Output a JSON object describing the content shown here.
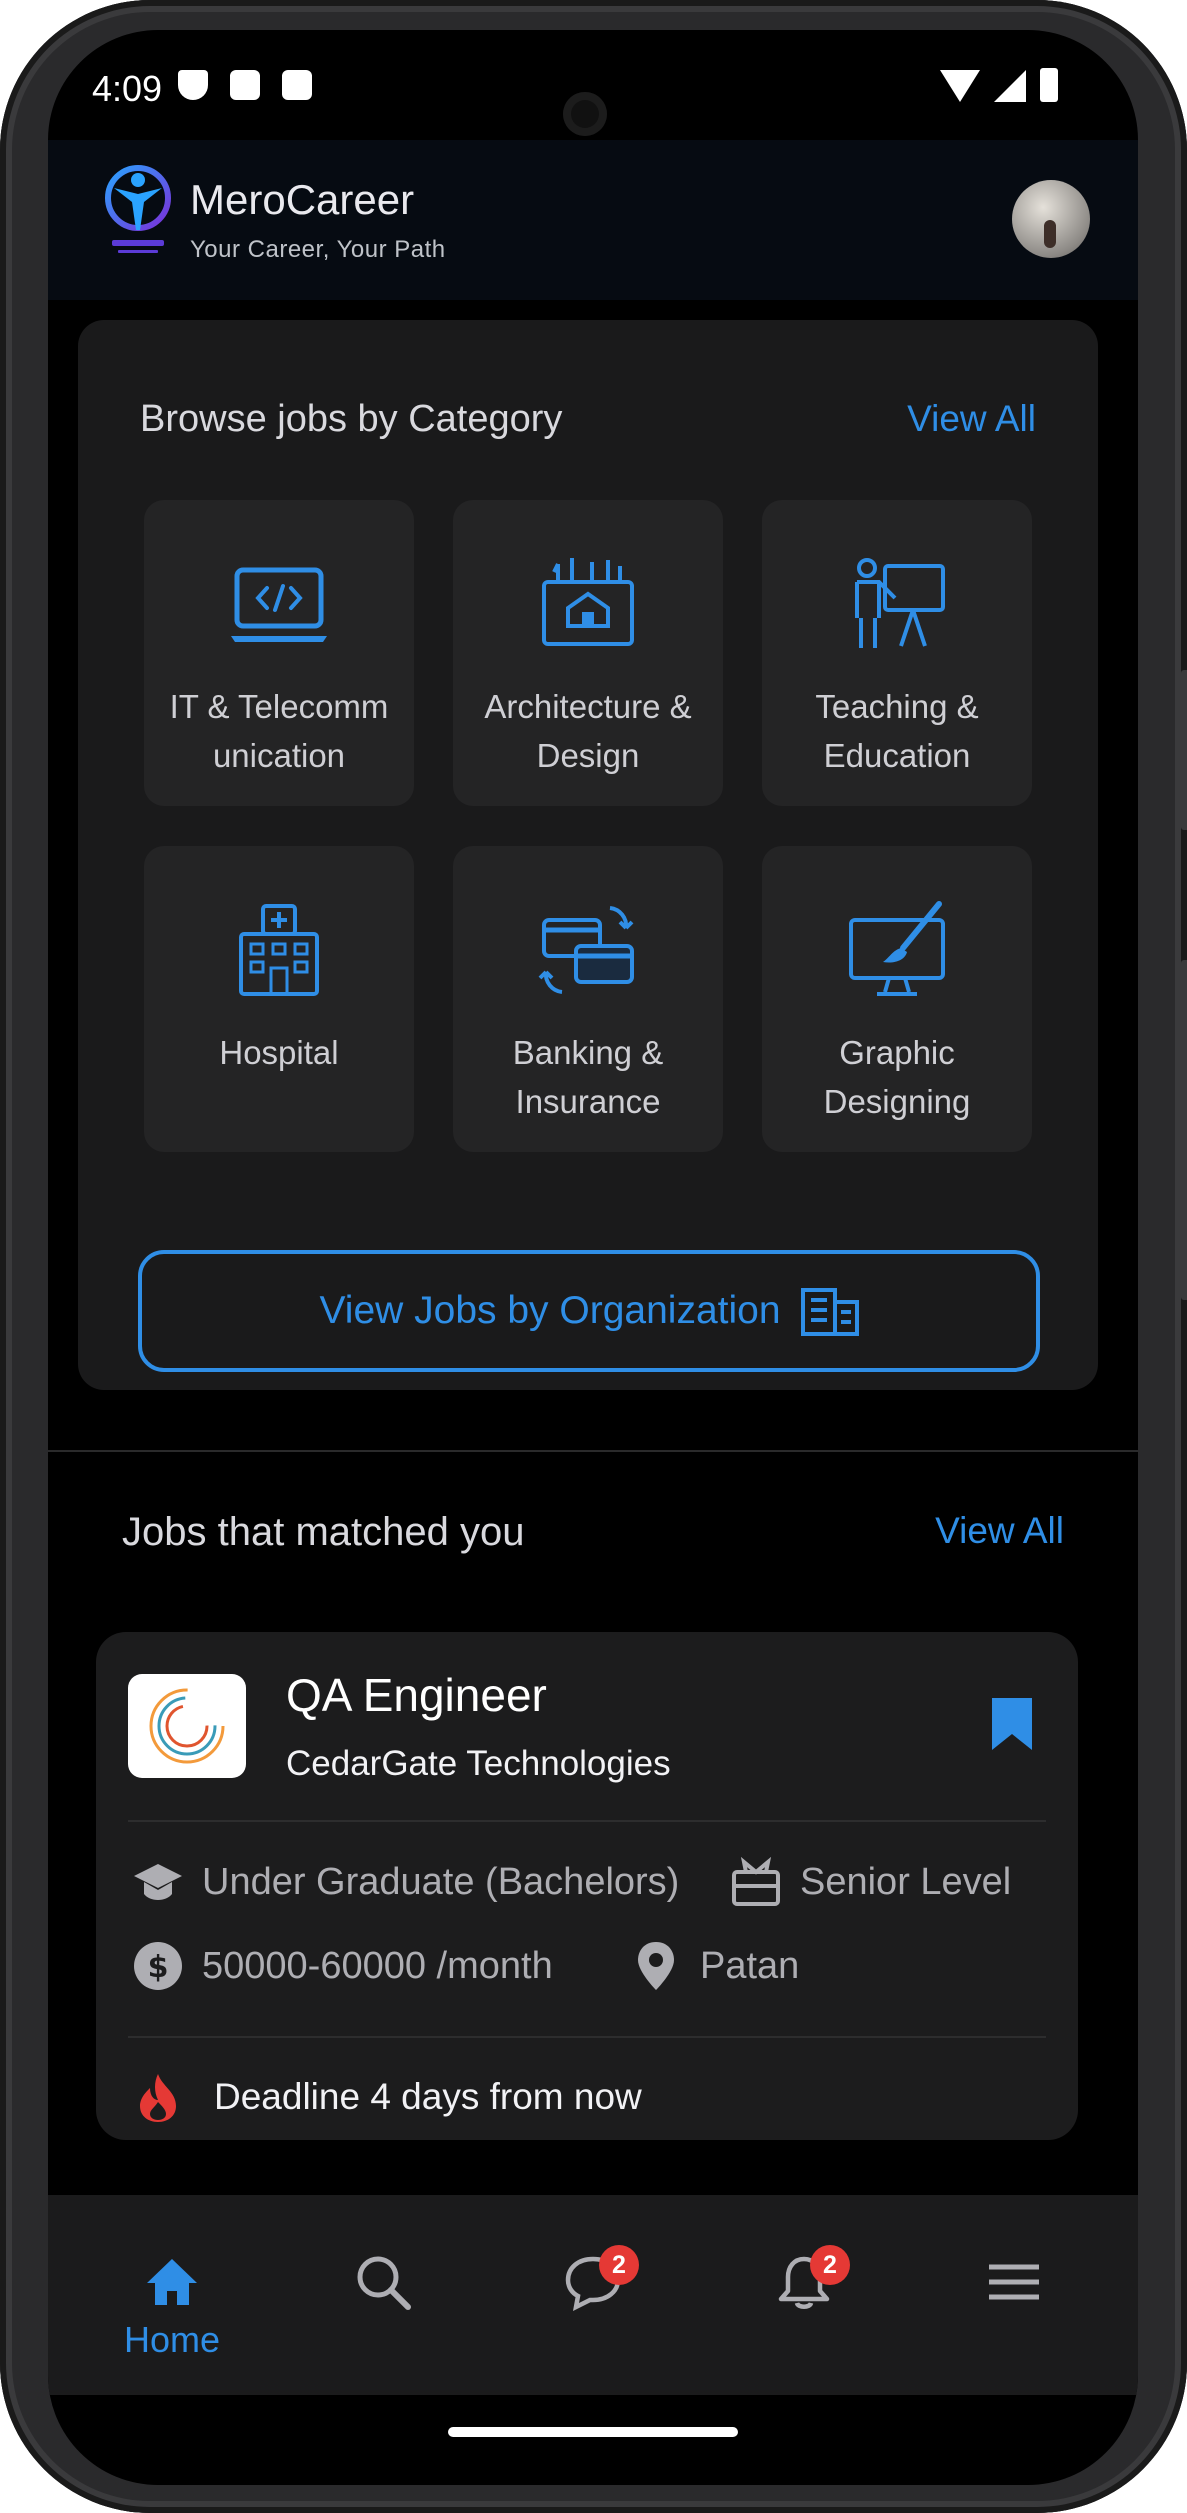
{
  "status_bar": {
    "time": "4:09"
  },
  "header": {
    "app_name": "MeroCareer",
    "tagline": "Your Career, Your Path"
  },
  "categories": {
    "title": "Browse jobs by Category",
    "view_all": "View All",
    "items": [
      {
        "label": "IT & Telecomm unication",
        "icon": "laptop-code-icon"
      },
      {
        "label": "Architecture & Design",
        "icon": "blueprint-icon"
      },
      {
        "label": "Teaching & Education",
        "icon": "teacher-board-icon"
      },
      {
        "label": "Hospital",
        "icon": "hospital-icon"
      },
      {
        "label": "Banking & Insurance",
        "icon": "card-exchange-icon"
      },
      {
        "label": "Graphic Designing",
        "icon": "monitor-brush-icon"
      }
    ],
    "org_button": "View Jobs by Organization"
  },
  "matches": {
    "title": "Jobs that matched you",
    "view_all": "View All",
    "job": {
      "title": "QA Engineer",
      "company": "CedarGate Technologies",
      "education": "Under Graduate (Bachelors)",
      "level": "Senior Level",
      "salary": "50000-60000 /month",
      "location": "Patan",
      "deadline": "Deadline 4 days from now"
    }
  },
  "bottom_nav": {
    "home_label": "Home",
    "messages_badge": "2",
    "notifications_badge": "2"
  },
  "colors": {
    "accent": "#2f8ee6",
    "badge": "#e53935",
    "deadline_icon": "#e53935"
  }
}
